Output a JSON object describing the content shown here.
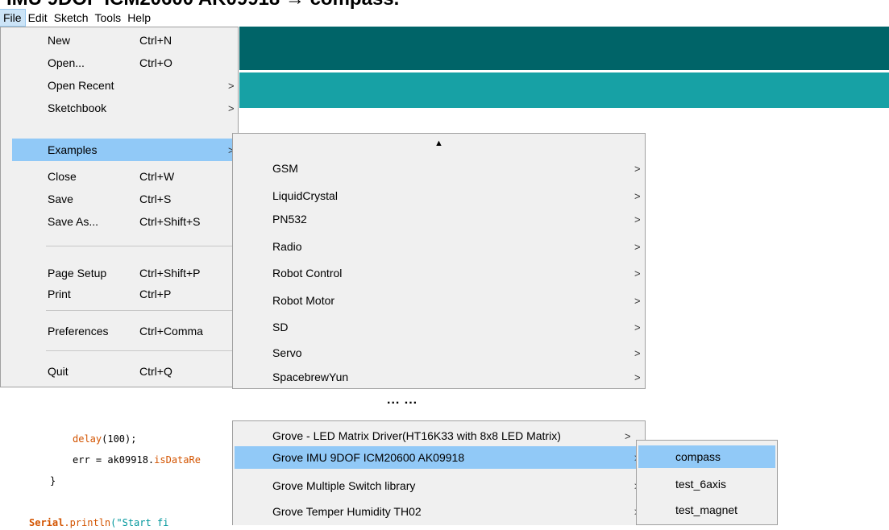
{
  "title_fragment": "IMU 9DOF ICM20600 AK09918 → compass.",
  "menubar": [
    "File",
    "Edit",
    "Sketch",
    "Tools",
    "Help"
  ],
  "file_menu": {
    "items": [
      {
        "label": "New",
        "shortcut": "Ctrl+N"
      },
      {
        "label": "Open...",
        "shortcut": "Ctrl+O"
      },
      {
        "label": "Open Recent",
        "arrow": ">"
      },
      {
        "label": "Sketchbook",
        "arrow": ">"
      },
      {
        "label": "Examples",
        "arrow": ">"
      },
      {
        "label": "Close",
        "shortcut": "Ctrl+W"
      },
      {
        "label": "Save",
        "shortcut": "Ctrl+S"
      },
      {
        "label": "Save As...",
        "shortcut": "Ctrl+Shift+S"
      },
      {
        "label": "Page Setup",
        "shortcut": "Ctrl+Shift+P"
      },
      {
        "label": "Print",
        "shortcut": "Ctrl+P"
      },
      {
        "label": "Preferences",
        "shortcut": "Ctrl+Comma"
      },
      {
        "label": "Quit",
        "shortcut": "Ctrl+Q"
      }
    ]
  },
  "examples_menu": {
    "scroll_up": "▲",
    "items": [
      "GSM",
      "LiquidCrystal",
      "PN532",
      "Radio",
      "Robot Control",
      "Robot Motor",
      "SD",
      "Servo",
      "SpacebrewYun"
    ],
    "arrow": ">"
  },
  "ellipsis": "... ...",
  "examples_lower": {
    "items": [
      "Grove - LED Matrix Driver(HT16K33 with 8x8 LED Matrix)",
      "Grove IMU 9DOF ICM20600 AK09918",
      "Grove Multiple Switch library",
      "Grove Temper Humidity TH02"
    ],
    "arrow": ">"
  },
  "library_menu": {
    "items": [
      "compass",
      "test_6axis",
      "test_magnet"
    ]
  },
  "code": {
    "line1_fn": "delay",
    "line1_rest": "(100);",
    "line2_a": "err = ak09918.",
    "line2_fn": "isDataRe",
    "line3": "}",
    "line4_obj": "Serial",
    "line4_fn": ".println",
    "line4_str": "(\"Start fi"
  },
  "colors": {
    "toolbar": "#006468",
    "tabbar": "#17a1a5",
    "highlight": "#91c9f7",
    "menu_bg": "#f0f0f0"
  }
}
